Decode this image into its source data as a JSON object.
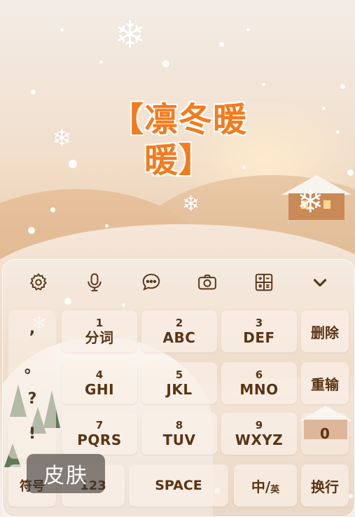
{
  "banner": {
    "title_line1": "【凛冬暖",
    "title_line2": "暖】"
  },
  "toolbar": {
    "items": [
      {
        "name": "settings",
        "icon": "gear-icon"
      },
      {
        "name": "voice",
        "icon": "microphone-icon"
      },
      {
        "name": "chat",
        "icon": "speech-bubble-icon"
      },
      {
        "name": "camera",
        "icon": "camera-icon"
      },
      {
        "name": "calculator",
        "icon": "calculator-icon"
      },
      {
        "name": "collapse",
        "icon": "chevron-down-icon"
      }
    ]
  },
  "keyboard": {
    "symbols": [
      ",",
      "。",
      "?",
      "!"
    ],
    "keys": [
      {
        "num": "1",
        "label": "分词"
      },
      {
        "num": "2",
        "label": "ABC"
      },
      {
        "num": "3",
        "label": "DEF"
      },
      {
        "num": "4",
        "label": "GHI"
      },
      {
        "num": "5",
        "label": "JKL"
      },
      {
        "num": "6",
        "label": "MNO"
      },
      {
        "num": "7",
        "label": "PQRS"
      },
      {
        "num": "8",
        "label": "TUV"
      },
      {
        "num": "9",
        "label": "WXYZ"
      }
    ],
    "delete": "删除",
    "reenter": "重输",
    "zero": "0",
    "symbols_key": "符号",
    "num_key": "123",
    "space": "SPACE",
    "lang_zh": "中/",
    "lang_en": "英",
    "newline": "换行"
  },
  "skin_tip": "皮肤",
  "colors": {
    "accent_title": "#f57b1d",
    "key_text": "#5b3413"
  }
}
